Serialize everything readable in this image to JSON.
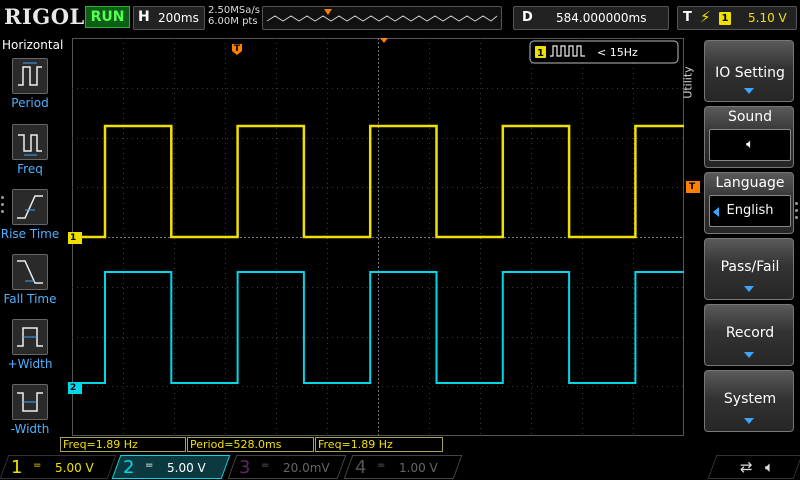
{
  "header": {
    "brand": "RIGOL",
    "run_state": "RUN",
    "horizontal": {
      "key": "H",
      "timebase": "200ms"
    },
    "sample_rate": "2.50MSa/s",
    "memory_depth": "6.00M pts",
    "delay": {
      "key": "D",
      "value": "584.000000ms"
    },
    "trigger": {
      "key": "T",
      "slope_glyph": "⚡",
      "source": "1",
      "level": "5.10 V"
    }
  },
  "left_panel": {
    "title": "Horizontal",
    "items": [
      {
        "label": "Period",
        "icon": "period-icon"
      },
      {
        "label": "Freq",
        "icon": "freq-icon"
      },
      {
        "label": "Rise Time",
        "icon": "rise-time-icon"
      },
      {
        "label": "Fall Time",
        "icon": "fall-time-icon"
      },
      {
        "label": "+Width",
        "icon": "positive-width-icon"
      },
      {
        "label": "-Width",
        "icon": "negative-width-icon"
      }
    ]
  },
  "counter_label": {
    "channel": "1",
    "text": "< 15Hz"
  },
  "markers": {
    "ch1": "1",
    "ch2": "2",
    "trigger_top": "T",
    "trigger_level": "T"
  },
  "measurements": [
    {
      "text": "Freq=1.89 Hz"
    },
    {
      "text": "Period=528.0ms"
    },
    {
      "text": "Freq=1.89 Hz"
    }
  ],
  "channels": [
    {
      "num": "1",
      "coupling": "=",
      "scale": "5.00 V",
      "color": "#f0e000"
    },
    {
      "num": "2",
      "coupling": "=",
      "scale": "5.00 V",
      "color": "#00d8e8"
    },
    {
      "num": "3",
      "coupling": "=",
      "scale": "20.0mV",
      "color": "#b040c0"
    },
    {
      "num": "4",
      "coupling": "=",
      "scale": "1.00 V",
      "color": "#3070ff"
    }
  ],
  "right_menu": {
    "title": "Utility",
    "buttons": [
      {
        "label": "IO Setting"
      },
      {
        "label": "Sound",
        "value_glyph": "🔈︎"
      },
      {
        "label": "Language",
        "value": "English"
      },
      {
        "label": "Pass/Fail"
      },
      {
        "label": "Record"
      },
      {
        "label": "System"
      }
    ]
  },
  "status": {
    "usb_glyph": "⇄",
    "sound_glyph": "🔈︎"
  },
  "colors": {
    "ch1": "#f0e000",
    "ch2": "#00d8e8",
    "trigger": "#ff8000",
    "accent": "#3aa6ff"
  }
}
